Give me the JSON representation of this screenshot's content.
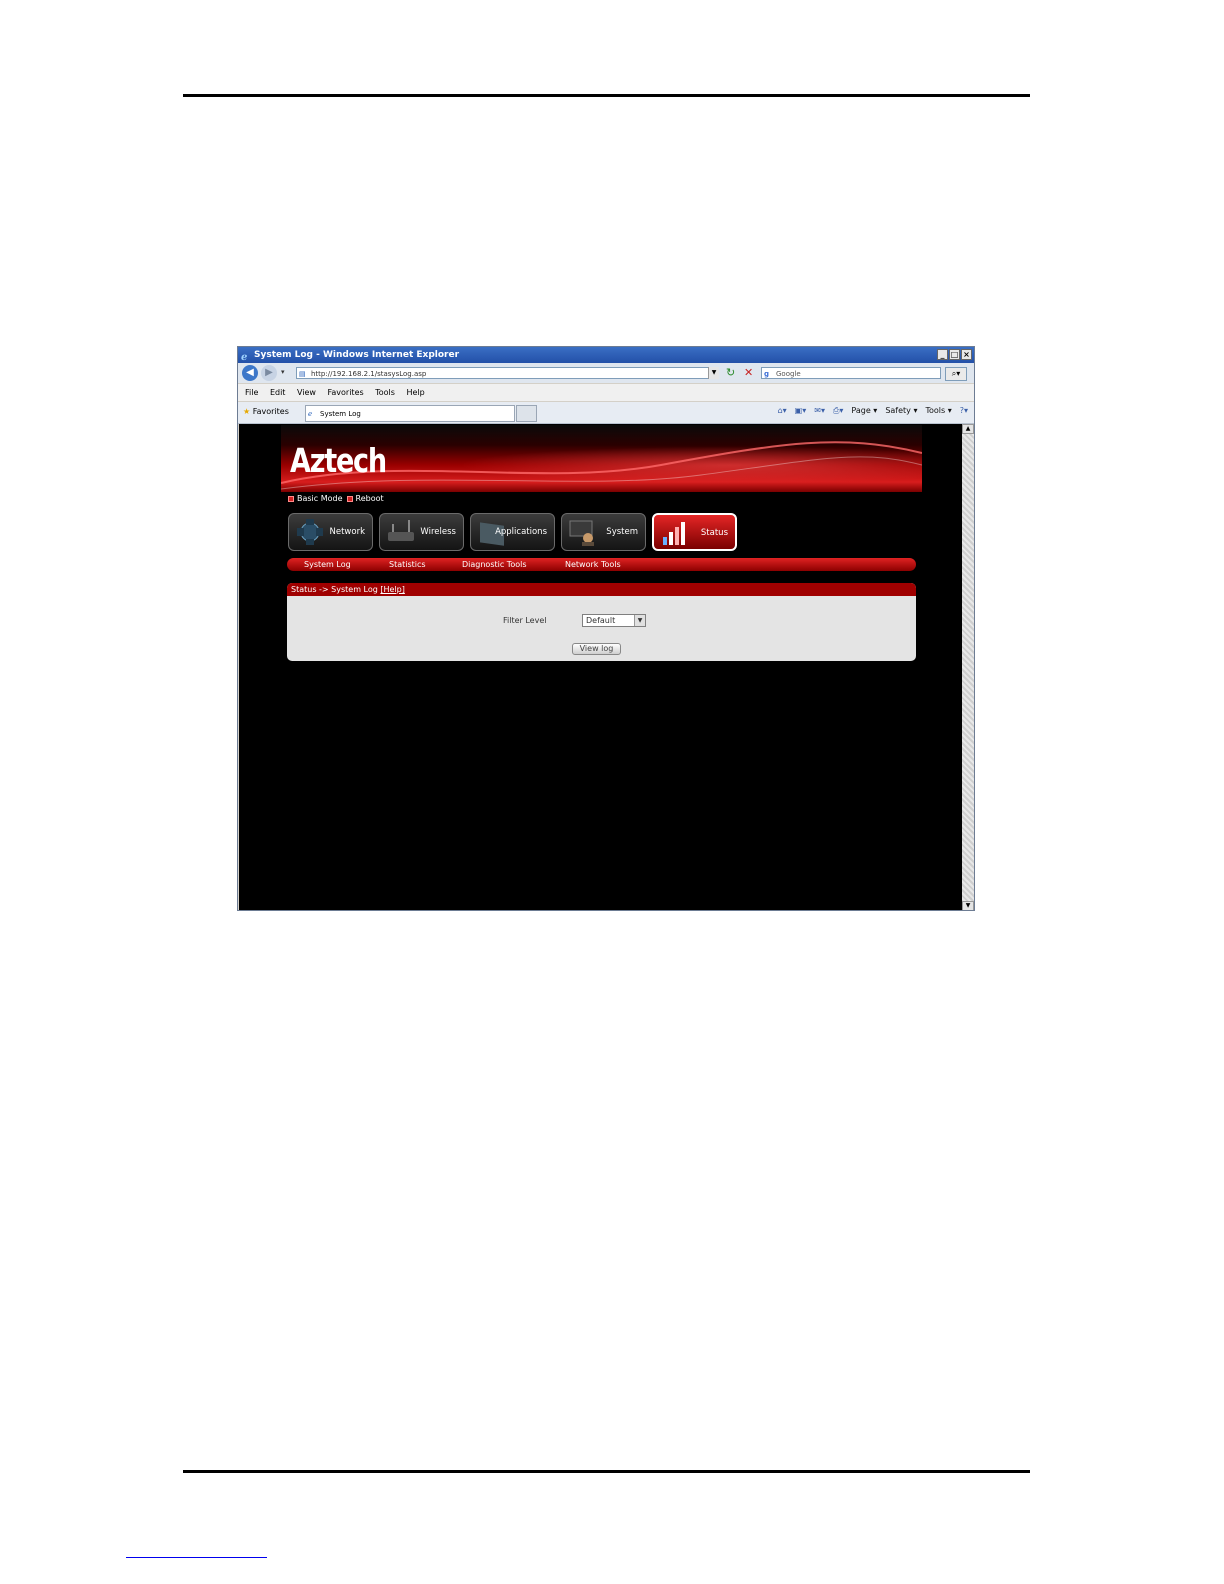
{
  "browser": {
    "title": "System Log - Windows Internet Explorer",
    "url": "http://192.168.2.1/stasysLog.asp",
    "search_placeholder": "Google",
    "menu": [
      "File",
      "Edit",
      "View",
      "Favorites",
      "Tools",
      "Help"
    ],
    "favorites_label": "Favorites",
    "tab_label": "System Log",
    "commands": [
      "Page ▾",
      "Safety ▾",
      "Tools ▾"
    ]
  },
  "app": {
    "logo": "Aztech",
    "quick_links": [
      "Basic Mode",
      "Reboot"
    ],
    "main_menu": [
      {
        "label": "Network",
        "active": false
      },
      {
        "label": "Wireless",
        "active": false
      },
      {
        "label": "Applications",
        "active": false
      },
      {
        "label": "System",
        "active": false
      },
      {
        "label": "Status",
        "active": true
      }
    ],
    "sub_menu": [
      "System Log",
      "Statistics",
      "Diagnostic Tools",
      "Network Tools"
    ],
    "breadcrumb": "Status -> System Log",
    "help_link": "[Help]",
    "filter_label": "Filter Level",
    "filter_value": "Default",
    "view_log_button": "View log"
  },
  "colors": {
    "accent_red": "#c40000",
    "panel_bg": "#e4e4e4",
    "page_bg": "#000000"
  }
}
